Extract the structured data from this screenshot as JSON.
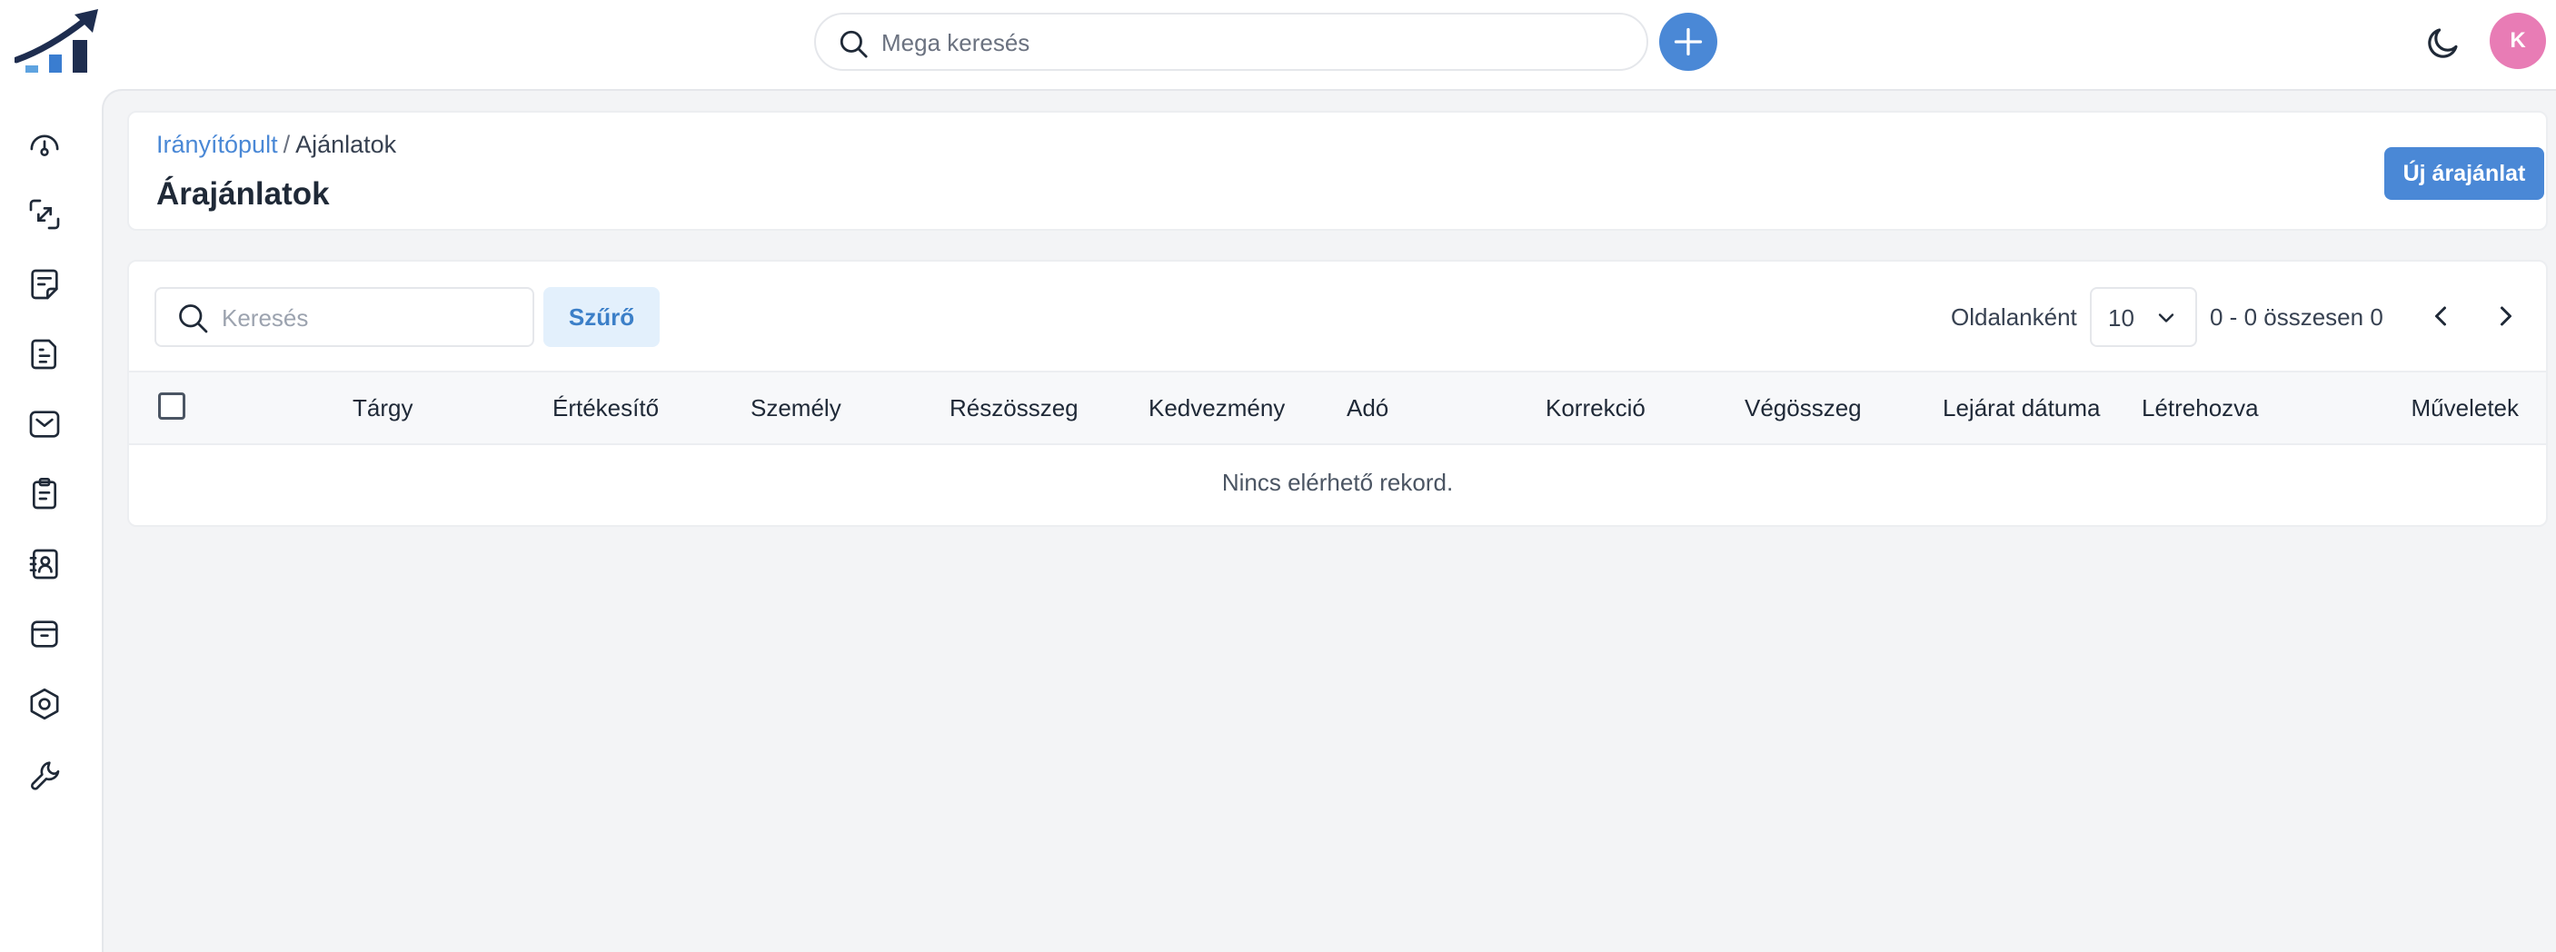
{
  "colors": {
    "accent": "#4a88d6",
    "avatar_bg": "#e87cb5",
    "filter_bg": "#e3f0fc",
    "page_bg": "#f3f4f6"
  },
  "topbar": {
    "logo_icon": "growth-chart-logo-icon",
    "search_placeholder": "Mega keresés",
    "add_icon": "plus-icon",
    "theme_icon": "moon-icon",
    "avatar_initial": "K"
  },
  "sidebar": {
    "items": [
      {
        "icon": "dashboard-gauge-icon"
      },
      {
        "icon": "deals-exchange-icon"
      },
      {
        "icon": "note-document-icon"
      },
      {
        "icon": "invoice-document-icon"
      },
      {
        "icon": "mail-icon"
      },
      {
        "icon": "clipboard-icon"
      },
      {
        "icon": "contacts-book-icon"
      },
      {
        "icon": "archive-box-icon"
      },
      {
        "icon": "settings-hexagon-icon"
      },
      {
        "icon": "wrench-icon"
      }
    ]
  },
  "header": {
    "breadcrumb_link": "Irányítópult",
    "breadcrumb_sep": "/",
    "breadcrumb_current": "Ajánlatok",
    "title": "Árajánlatok",
    "new_button": "Új árajánlat"
  },
  "toolbar": {
    "search_placeholder": "Keresés",
    "filter_button": "Szűrő",
    "per_page_label": "Oldalanként",
    "per_page_value": "10",
    "range_text": "0 - 0 összesen 0"
  },
  "table": {
    "columns": [
      "Tárgy",
      "Értékesítő",
      "Személy",
      "Részösszeg",
      "Kedvezmény",
      "Adó",
      "Korrekció",
      "Végösszeg",
      "Lejárat dátuma",
      "Létrehozva",
      "Műveletek"
    ],
    "empty_message": "Nincs elérhető rekord."
  }
}
